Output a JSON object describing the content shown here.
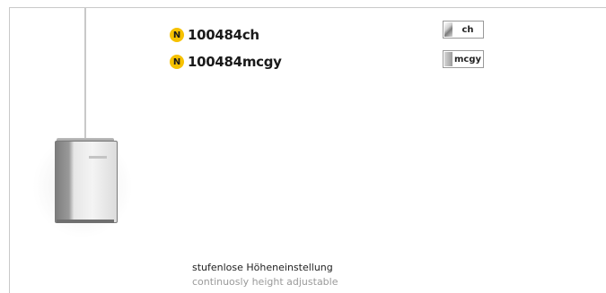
{
  "product_image": {
    "icon": "pendant-box-icon"
  },
  "products": [
    {
      "badge": "N",
      "code": "100484ch"
    },
    {
      "badge": "N",
      "code": "100484mcgy"
    }
  ],
  "finishes": [
    {
      "label": "ch",
      "color": "#c0c0c0"
    },
    {
      "label": "mcgy",
      "color": "#a8a8a8"
    }
  ],
  "caption": {
    "de": "stufenlose Höheneinstellung",
    "en": "continuosly height adjustable"
  },
  "colors": {
    "badge": "#f6c100",
    "frame": "#c9c9c9",
    "caption_en": "#9a9a9a"
  }
}
